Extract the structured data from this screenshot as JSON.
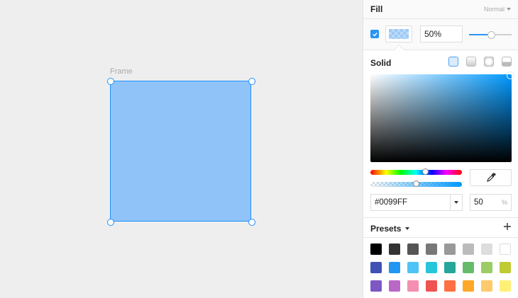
{
  "canvas": {
    "frame_label": "Frame",
    "frame_color": "#90c4f8",
    "selection_color": "#1e90ff"
  },
  "fill_panel": {
    "title": "Fill",
    "blend_mode": "Normal",
    "enabled": true,
    "opacity_value": "50%",
    "opacity_slider_level": 0.5,
    "accent_color": "#2a94f4"
  },
  "color_picker": {
    "mode_label": "Solid",
    "fill_types": [
      "solid",
      "linear-gradient",
      "radial-gradient",
      "image"
    ],
    "hex_value": "#0099FF",
    "alpha_value": "50",
    "alpha_unit": "%",
    "hue_level": 0.6,
    "alpha_level": 0.5,
    "icons": [
      "eyedropper-icon",
      "chevron-down-icon"
    ]
  },
  "presets": {
    "label": "Presets",
    "add_icon": "plus-icon",
    "colors": [
      "#000000",
      "#333333",
      "#555555",
      "#777777",
      "#999999",
      "#bbbbbb",
      "#dddddd",
      "#ffffff",
      "#3f51b5",
      "#2196f3",
      "#4fc3f7",
      "#26c6da",
      "#26a69a",
      "#66bb6a",
      "#9ccc65",
      "#c0ca33",
      "#7e57c2",
      "#ba68c8",
      "#f48fb1",
      "#ef5350",
      "#ff7043",
      "#ffa726",
      "#ffca6b",
      "#fff176"
    ]
  }
}
